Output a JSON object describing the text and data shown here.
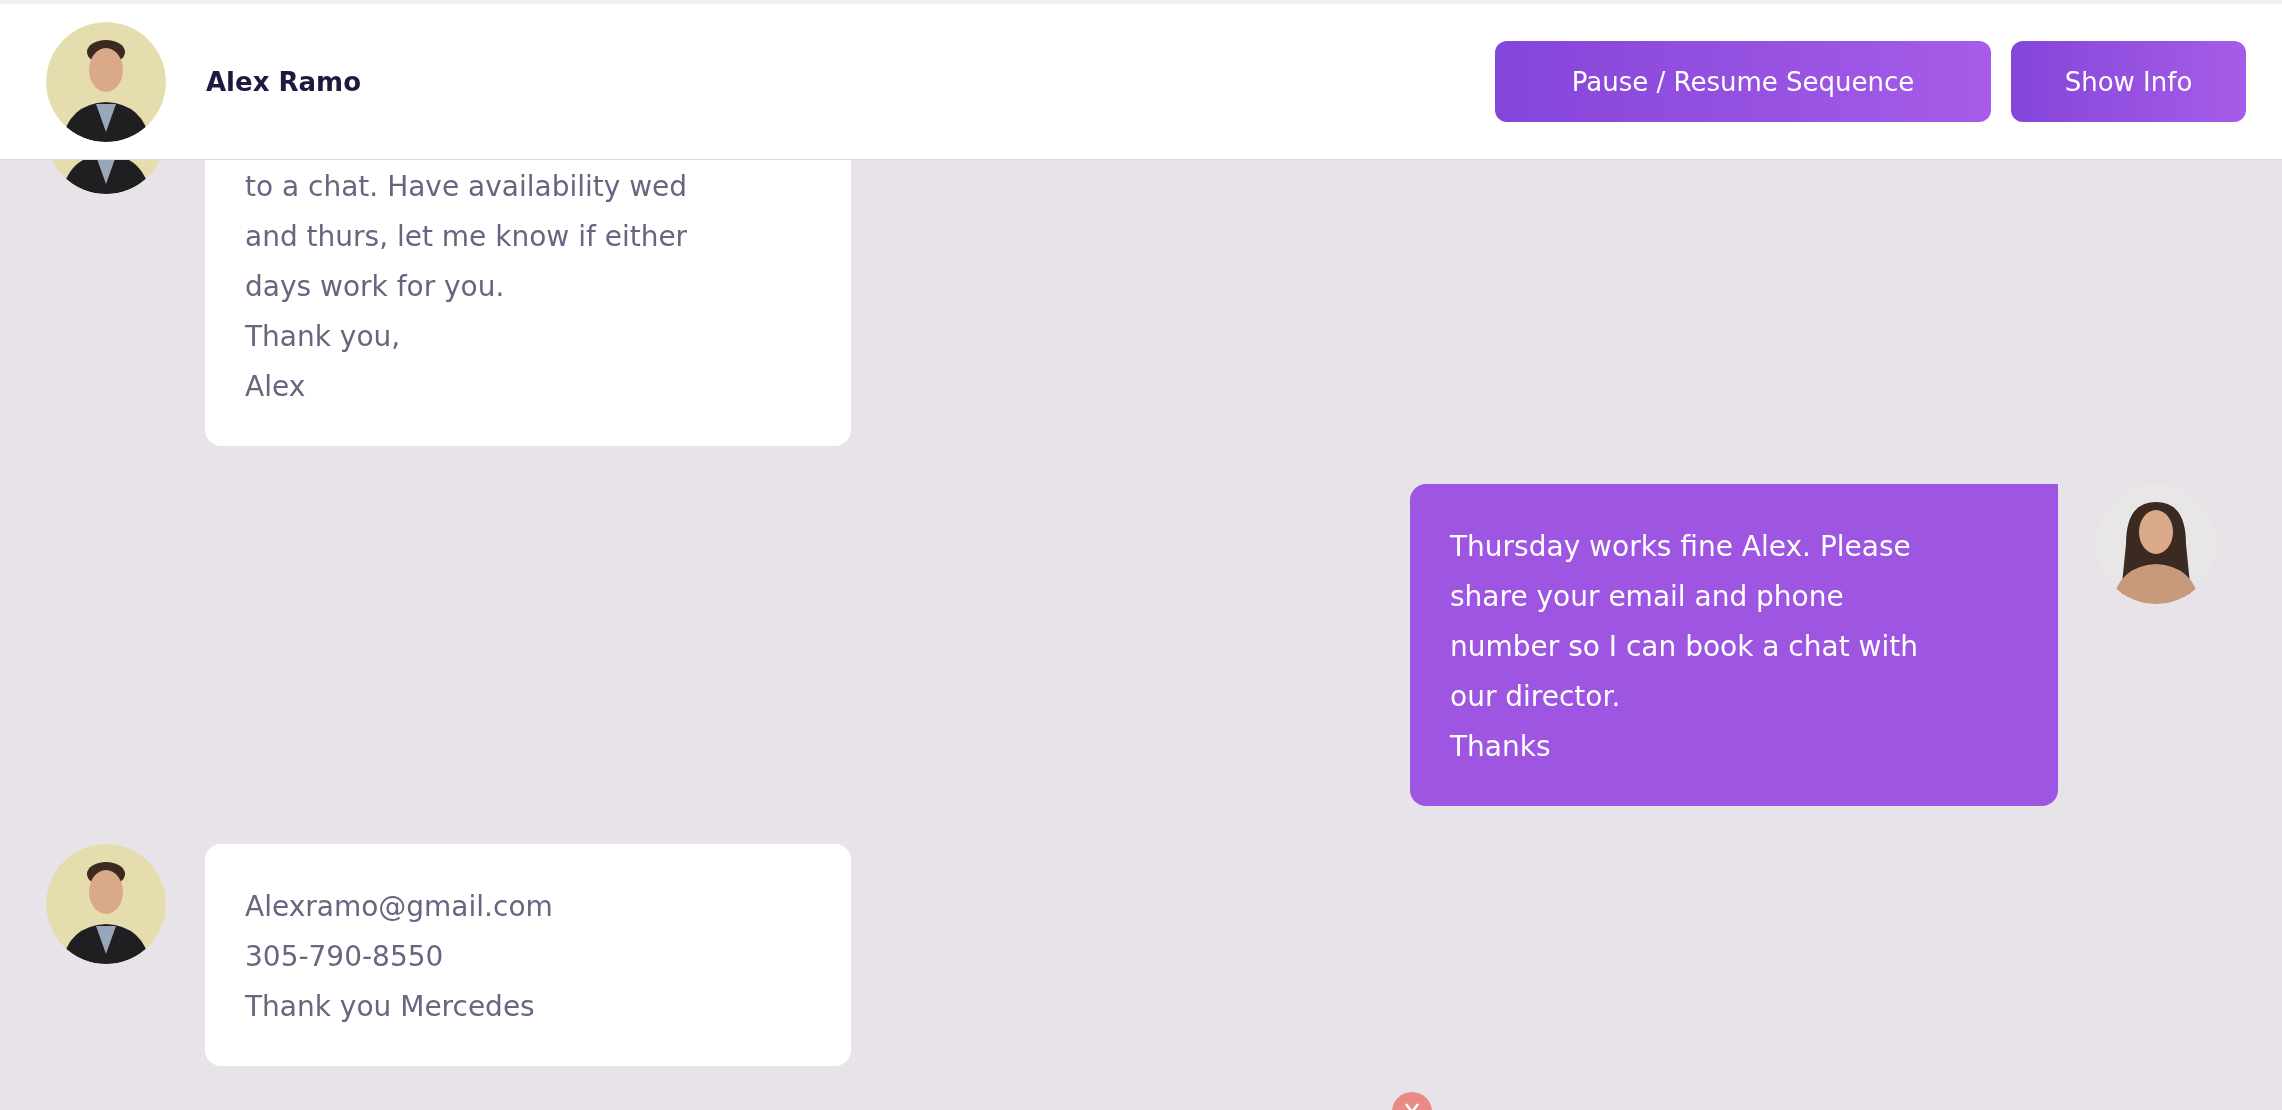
{
  "header": {
    "contact_name": "Alex Ramo",
    "buttons": [
      {
        "label": "Pause / Resume Sequence"
      },
      {
        "label": "Show Info"
      }
    ]
  },
  "messages": [
    {
      "kind": "incoming",
      "text": "to a chat. Have availability wed\nand thurs, let me know if either\ndays work for you.\nThank you,\nAlex"
    },
    {
      "kind": "outgoing",
      "text": "Thursday works fine Alex. Please\nshare your email and phone\nnumber so I can book a chat with\nour director.\nThanks"
    },
    {
      "kind": "incoming",
      "text": "Alexramo@gmail.com\n305-790-8550\nThank you Mercedes"
    }
  ]
}
